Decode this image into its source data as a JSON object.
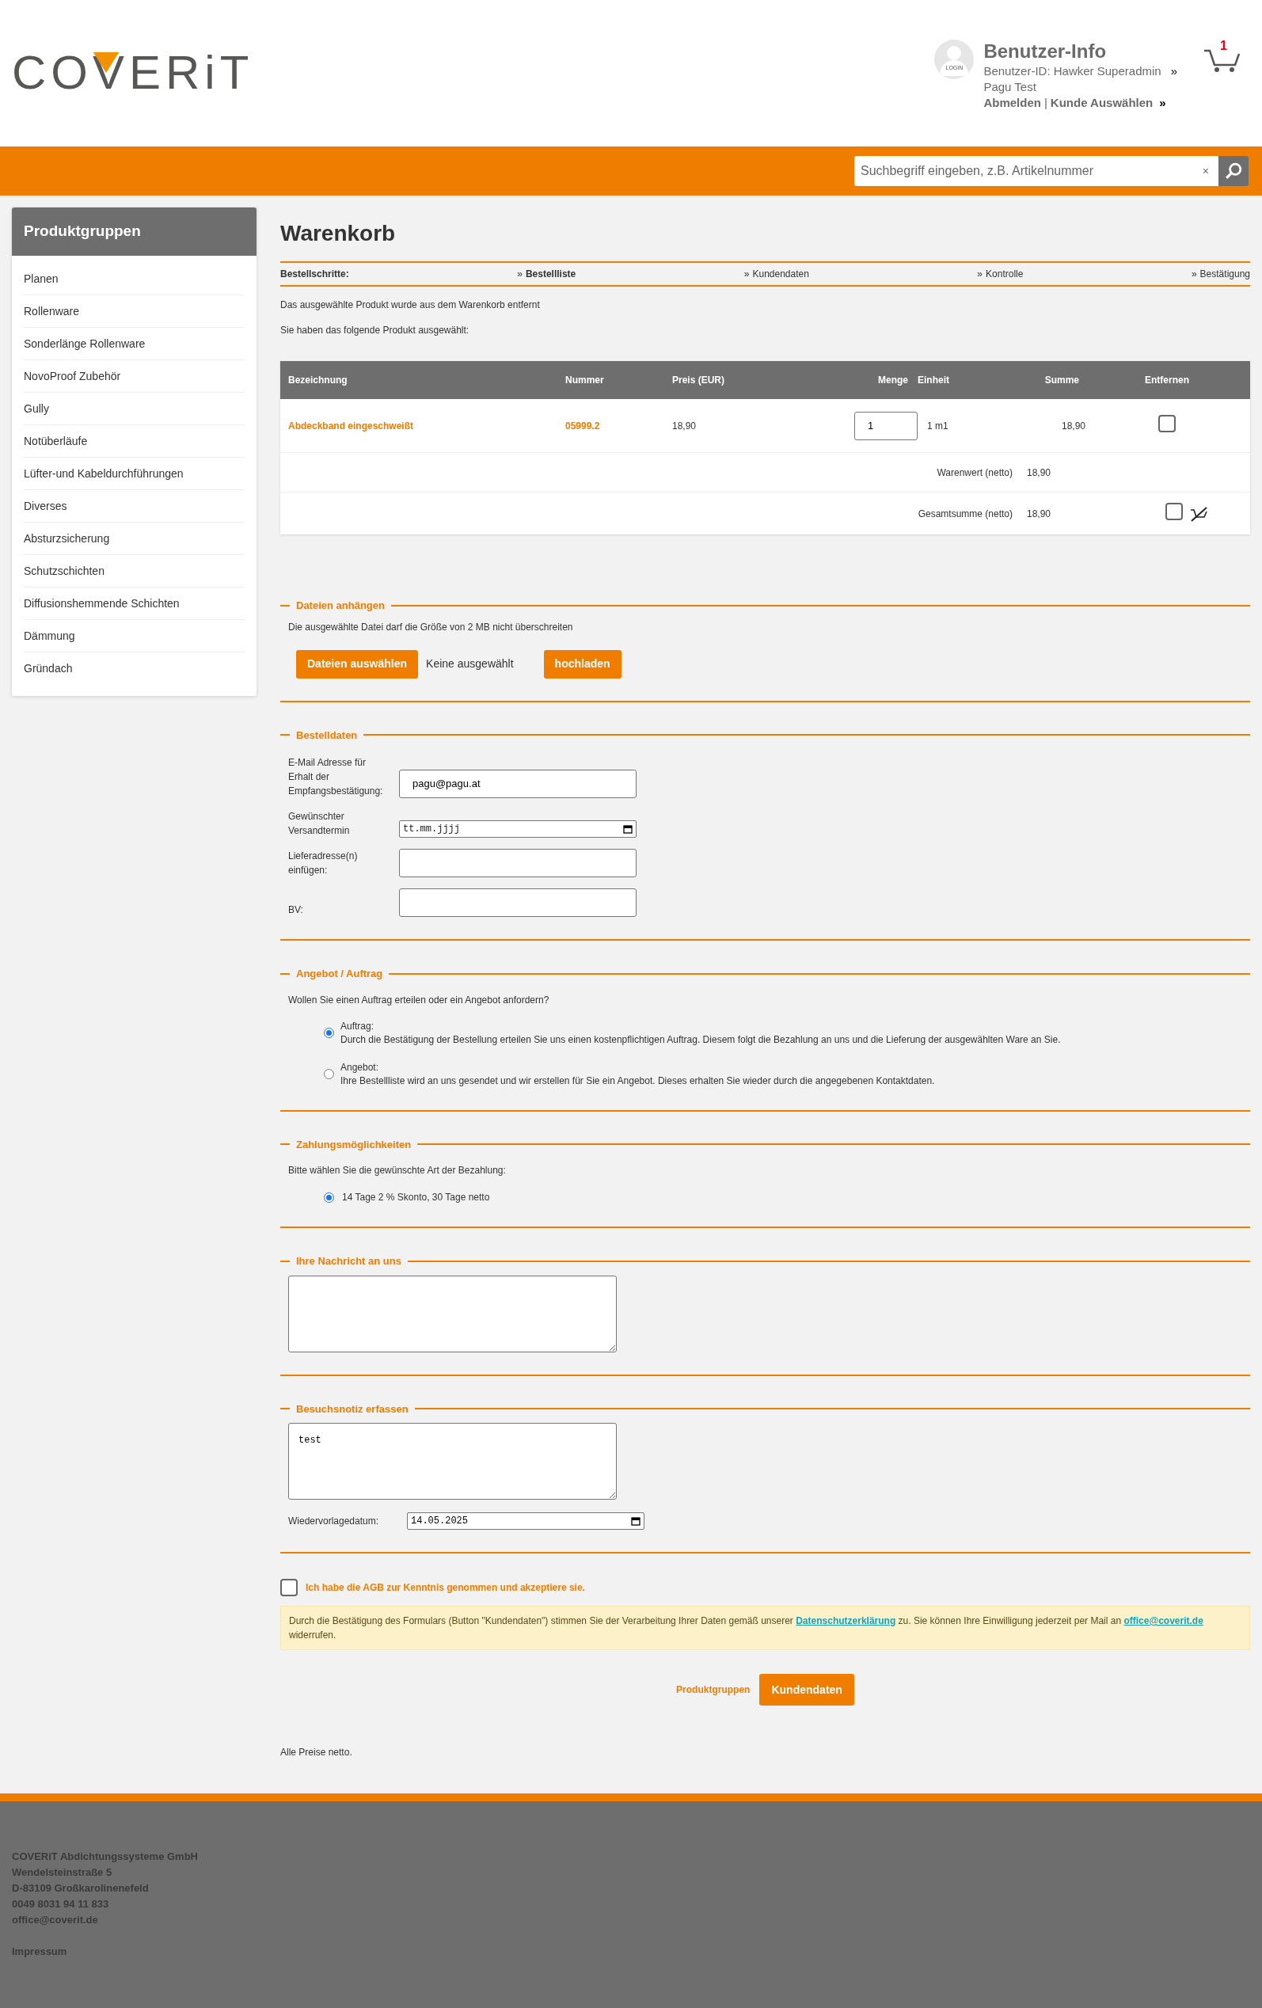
{
  "header": {
    "logo": "COVERiT",
    "avatar_label": "LOGIN",
    "user_title": "Benutzer-Info",
    "user_id": "Benutzer-ID: Hawker Superadmin",
    "user_id_mark": "»",
    "user_name": "Pagu Test",
    "logout": "Abmelden",
    "separator": "|",
    "select_customer": "Kunde Auswählen",
    "select_mark": "»",
    "cart_count": "1"
  },
  "search": {
    "placeholder": "Suchbegriff eingeben, z.B. Artikelnummer",
    "clear": "×"
  },
  "sidebar": {
    "title": "Produktgruppen",
    "items": [
      "Planen",
      "Rollenware",
      "Sonderlänge Rollenware",
      "NovoProof Zubehör",
      "Gully",
      "Notüberläufe",
      "Lüfter-und Kabeldurchführungen",
      "Diverses",
      "Absturzsicherung",
      "Schutzschichten",
      "Diffusionshemmende Schichten",
      "Dämmung",
      "Gründach"
    ]
  },
  "page_title": "Warenkorb",
  "steps": {
    "label": "Bestellschritte:",
    "items": [
      {
        "mark": "»",
        "label": "Bestellliste",
        "selected": true
      },
      {
        "mark": "»",
        "label": "Kundendaten",
        "selected": false
      },
      {
        "mark": "»",
        "label": "Kontrolle",
        "selected": false
      },
      {
        "mark": "»",
        "label": "Bestätigung",
        "selected": false
      }
    ]
  },
  "messages": [
    "Das ausgewählte Produkt wurde aus dem Warenkorb entfernt",
    "Sie haben das folgende Produkt ausgewählt:"
  ],
  "table": {
    "columns": [
      "Bezeichnung",
      "Nummer",
      "Preis (EUR)",
      "Menge",
      "Einheit",
      "Summe",
      "Entfernen"
    ],
    "rows": [
      {
        "name": "Abdeckband eingeschweißt",
        "number": "05999.2",
        "price": "18,90",
        "quantity": "1",
        "unit": "1 m1",
        "sum": "18,90",
        "remove": false
      }
    ],
    "net_label": "Warenwert (netto)",
    "net_value": "18,90",
    "total_label": "Gesamtsumme (netto)",
    "total_value": "18,90",
    "total_checked": false
  },
  "attachments": {
    "legend": "Dateien anhängen",
    "hint": "Die ausgewählte Datei darf die Größe von 2 MB nicht überschreiten",
    "choose": "Dateien auswählen",
    "file_status": "Keine ausgewählt",
    "upload": "hochladen"
  },
  "order_data": {
    "legend": "Bestelldaten",
    "fields": [
      {
        "kind": "text",
        "label": "E-Mail Adresse für Erhalt der Empfangsbestätigung:",
        "value": "pagu@pagu.at"
      },
      {
        "kind": "date",
        "label": "Gewünschter Versandtermin",
        "placeholder": "tt.mm.jjjj"
      },
      {
        "kind": "text",
        "label": "Lieferadresse(n) einfügen:"
      },
      {
        "kind": "text",
        "label": "BV:"
      }
    ]
  },
  "offer": {
    "legend": "Angebot / Auftrag",
    "question": "Wollen Sie einen Auftrag erteilen oder ein Angebot anfordern?",
    "options": [
      {
        "title": "Auftrag:",
        "text": "Durch die Bestätigung der Bestellung erteilen Sie uns einen kostenpflichtigen Auftrag. Diesem folgt die Bezahlung an uns und die Lieferung der ausgewählten Ware an Sie.",
        "selected": true
      },
      {
        "title": "Angebot:",
        "text": "Ihre Bestellliste wird an uns gesendet und wir erstellen für Sie ein Angebot. Dieses erhalten Sie wieder durch die angegebenen Kontaktdaten.",
        "selected": false
      }
    ]
  },
  "payment": {
    "legend": "Zahlungsmöglichkeiten",
    "question": "Bitte wählen Sie die gewünschte Art der Bezahlung:",
    "options": [
      {
        "text": "14 Tage 2 % Skonto, 30 Tage netto",
        "selected": true
      }
    ]
  },
  "message": {
    "legend": "Ihre Nachricht an uns"
  },
  "visit_note": {
    "legend": "Besuchsnotiz erfassen",
    "value": "test",
    "date_label": "Wiedervorlagedatum:",
    "date_value": "14.05.2025"
  },
  "agb": {
    "text": "Ich habe die AGB zur Kenntnis genommen und akzeptiere sie.",
    "checked": false
  },
  "consent": {
    "before": "Durch die Bestätigung des Formulars (Button \"Kundendaten\") stimmen Sie der Verarbeitung Ihrer Daten gemäß unserer",
    "link1": "Datenschutzerklärung",
    "middle": "zu. Sie können Ihre Einwilligung jederzeit per Mail an",
    "link2": "office@coverit.de",
    "after": "widerrufen."
  },
  "actions": {
    "back": "Produktgruppen",
    "next": "Kundendaten"
  },
  "note": "Alle Preise netto.",
  "footer": {
    "lines": [
      "COVERiT Abdichtungssysteme GmbH",
      "Wendelsteinstraße 5",
      "D-83109 Großkarolinenefeld",
      "0049 8031 94 11 833",
      "office@coverit.de"
    ],
    "imprint": "Impressum"
  }
}
